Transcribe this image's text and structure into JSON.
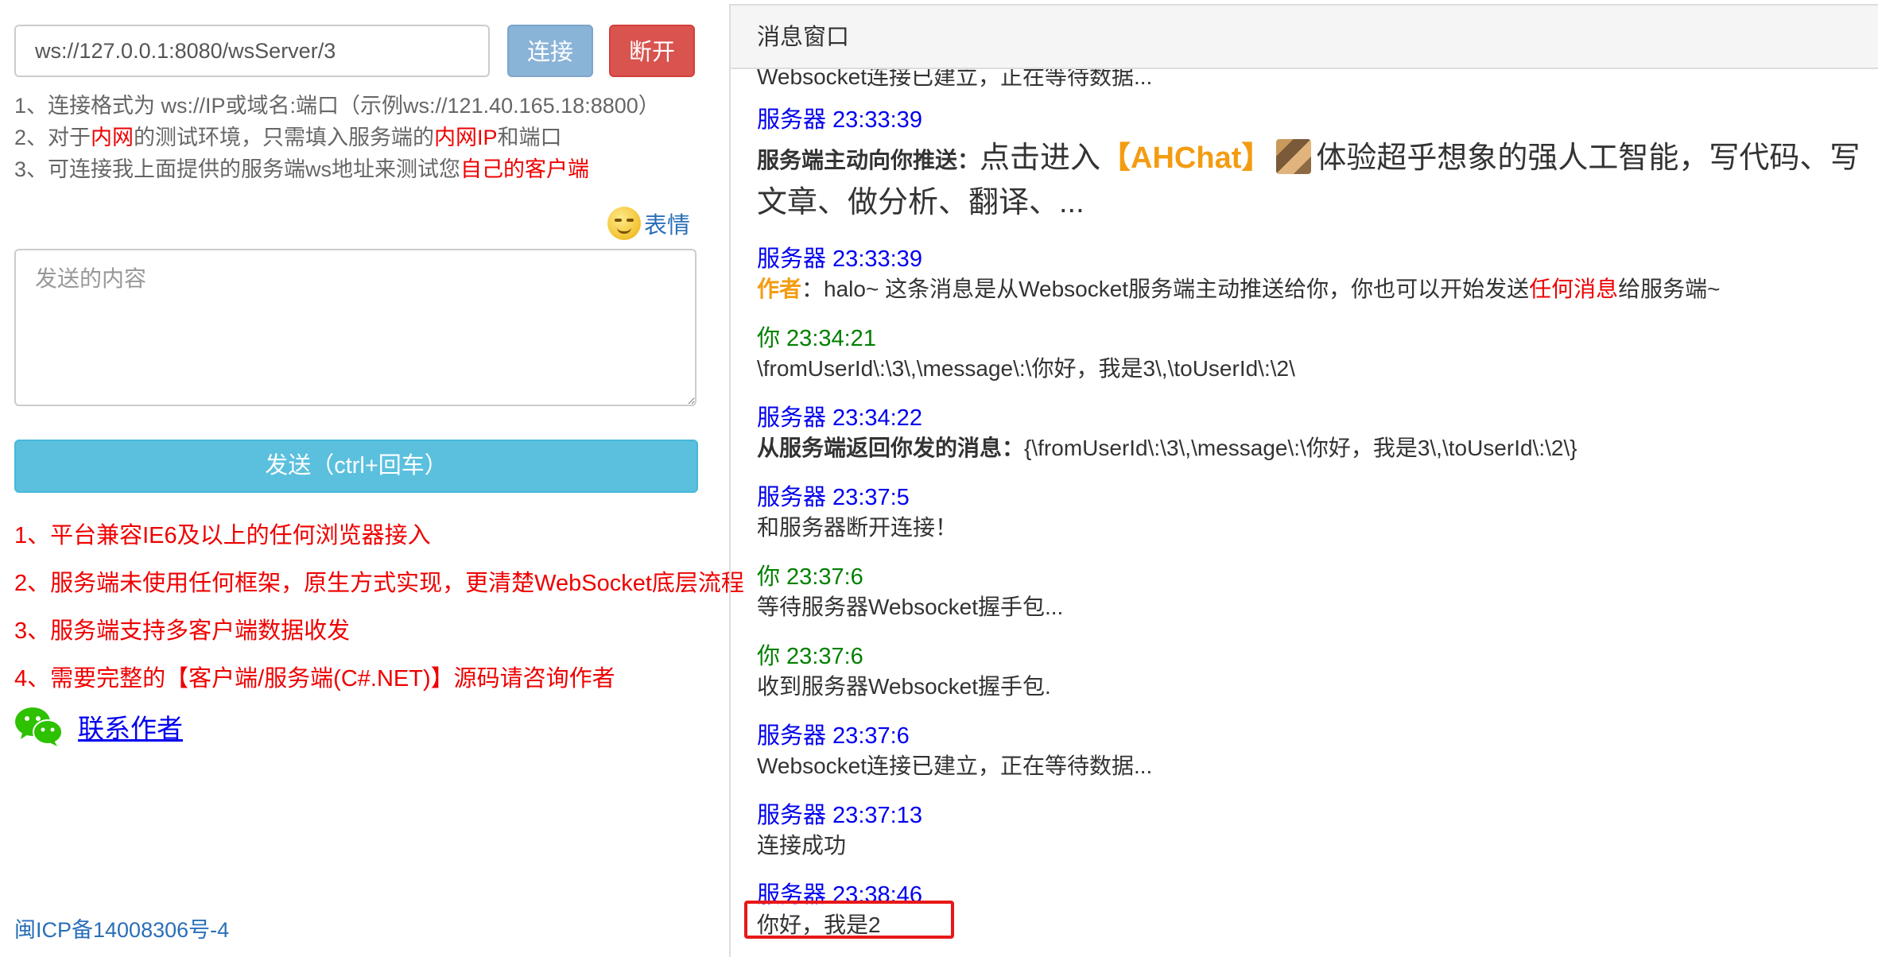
{
  "connection": {
    "url_value": "ws://127.0.0.1:8080/wsServer/3",
    "connect_label": "连接",
    "disconnect_label": "断开"
  },
  "tips": {
    "line1": "1、连接格式为 ws://IP或域名:端口（示例ws://121.40.165.18:8800）",
    "line2_a": "2、对于",
    "line2_b": "内网",
    "line2_c": "的测试环境，只需填入服务端的",
    "line2_d": "内网IP",
    "line2_e": "和端口",
    "line3_a": "3、可连接我上面提供的服务端ws地址来测试您",
    "line3_b": "自己的客户端"
  },
  "emoji": {
    "label": "表情"
  },
  "composer": {
    "placeholder": "发送的内容",
    "send_label": "发送（ctrl+回车）"
  },
  "features": [
    "1、平台兼容IE6及以上的任何浏览器接入",
    "2、服务端未使用任何框架，原生方式实现，更清楚WebSocket底层流程",
    "3、服务端支持多客户端数据收发",
    "4、需要完整的【客户端/服务端(C#.NET)】源码请咨询作者"
  ],
  "contact_label": "联系作者",
  "icp": "闽ICP备14008306号-4",
  "panel": {
    "title": "消息窗口",
    "cut_line": "Websocket连接已建立，正在等待数据...",
    "messages": [
      {
        "sender": "服务器 23:33:39",
        "label": "服务端主动向你推送：",
        "text_a": "点击进入",
        "link": "【AHChat】",
        "text_b": "体验超乎想象的强人工智能，写代码、写",
        "text_c": "文章、做分析、翻译、..."
      },
      {
        "sender": "服务器 23:33:39",
        "label": "作者",
        "text_a": "：halo~ 这条消息是从Websocket服务端主动推送给你，你也可以开始发送",
        "text_red": "任何消息",
        "text_b": "给服务端~"
      },
      {
        "sender": "你 23:34:21",
        "text": "\\fromUserId\\:\\3\\,\\message\\:\\你好，我是3\\,\\toUserId\\:\\2\\"
      },
      {
        "sender": "服务器 23:34:22",
        "label": "从服务端返回你发的消息：",
        "text": "{\\fromUserId\\:\\3\\,\\message\\:\\你好，我是3\\,\\toUserId\\:\\2\\}"
      },
      {
        "sender": "服务器 23:37:5",
        "text": "和服务器断开连接！"
      },
      {
        "sender": "你 23:37:6",
        "text": "等待服务器Websocket握手包..."
      },
      {
        "sender": "你 23:37:6",
        "text": "收到服务器Websocket握手包."
      },
      {
        "sender": "服务器 23:37:6",
        "text": "Websocket连接已建立，正在等待数据..."
      },
      {
        "sender": "服务器 23:37:13",
        "text": "连接成功"
      },
      {
        "sender": "服务器 23:38:46",
        "text": "你好，我是2"
      }
    ]
  }
}
